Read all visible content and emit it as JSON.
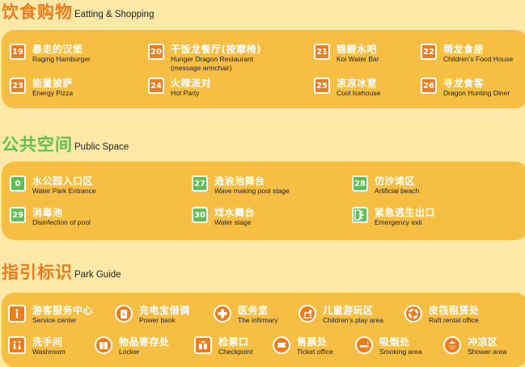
{
  "dining": {
    "title_cn": "饮食购物",
    "title_en": "Eatting & Shopping",
    "title_color": "#ec7d1e",
    "items": [
      {
        "num": "19",
        "cn": "暴走的汉堡",
        "en": "Raging Hamburger"
      },
      {
        "num": "20",
        "cn": "干饭龙餐厅(按摩椅)",
        "en": "Hunger Dragon Restaurant",
        "en2": "(message armchair)"
      },
      {
        "num": "21",
        "cn": "锦鲤水吧",
        "en": "Koi Water Bar"
      },
      {
        "num": "22",
        "cn": "萌龙食屋",
        "en": "Children’s Food House"
      },
      {
        "num": "23",
        "cn": "能量披萨",
        "en": "Energy Pizza"
      },
      {
        "num": "24",
        "cn": "火辣派对",
        "en": "Hot Party"
      },
      {
        "num": "25",
        "cn": "凉凉冰室",
        "en": "Cool Icehouse"
      },
      {
        "num": "26",
        "cn": "寻龙食客",
        "en": "Dragon Hunting Diner"
      }
    ]
  },
  "public": {
    "title_cn": "公共空间",
    "title_en": "Public Space",
    "title_color": "#5fbf52",
    "items": [
      {
        "num": "0",
        "cn": "水公园入口区",
        "en": "Water Park Entrance"
      },
      {
        "num": "27",
        "cn": "造浪池舞台",
        "en": "Wave making pool stage"
      },
      {
        "num": "28",
        "cn": "仿沙滩区",
        "en": "Artificial beach"
      },
      {
        "num": "29",
        "cn": "消毒池",
        "en": "Disinfection of pool"
      },
      {
        "num": "30",
        "cn": "戏水舞台",
        "en": "Water stage"
      },
      {
        "num": "",
        "cn": "紧急逃生出口",
        "en": "Emergency exit",
        "icon": "emergency-exit-icon"
      }
    ]
  },
  "guide": {
    "title_cn": "指引标识",
    "title_en": "Park Guide",
    "title_color": "#ec7d1e",
    "items": [
      {
        "icon": "info-icon",
        "cn": "游客服务中心",
        "en": "Service center"
      },
      {
        "icon": "power-bank-icon",
        "cn": "充电宝借调",
        "en": "Power bank"
      },
      {
        "icon": "first-aid-icon",
        "cn": "医务室",
        "en": "The infirmary"
      },
      {
        "icon": "rocking-horse-icon",
        "cn": "儿童游玩区",
        "en": "Children’s play area"
      },
      {
        "icon": "life-buoy-icon",
        "cn": "皮筏租赁处",
        "en": "Raft rental office"
      },
      {
        "icon": "washroom-icon",
        "cn": "洗手间",
        "en": "Washroom"
      },
      {
        "icon": "locker-icon",
        "cn": "物品寄存处",
        "en": "Locker"
      },
      {
        "icon": "checkpoint-icon",
        "cn": "检票口",
        "en": "Checkpoint"
      },
      {
        "icon": "ticket-icon",
        "cn": "售票处",
        "en": "Ticket office"
      },
      {
        "icon": "smoking-icon",
        "cn": "吸烟处",
        "en": "Smoking area"
      },
      {
        "icon": "shower-icon",
        "cn": "冲凉区",
        "en": "Shower area"
      }
    ]
  }
}
